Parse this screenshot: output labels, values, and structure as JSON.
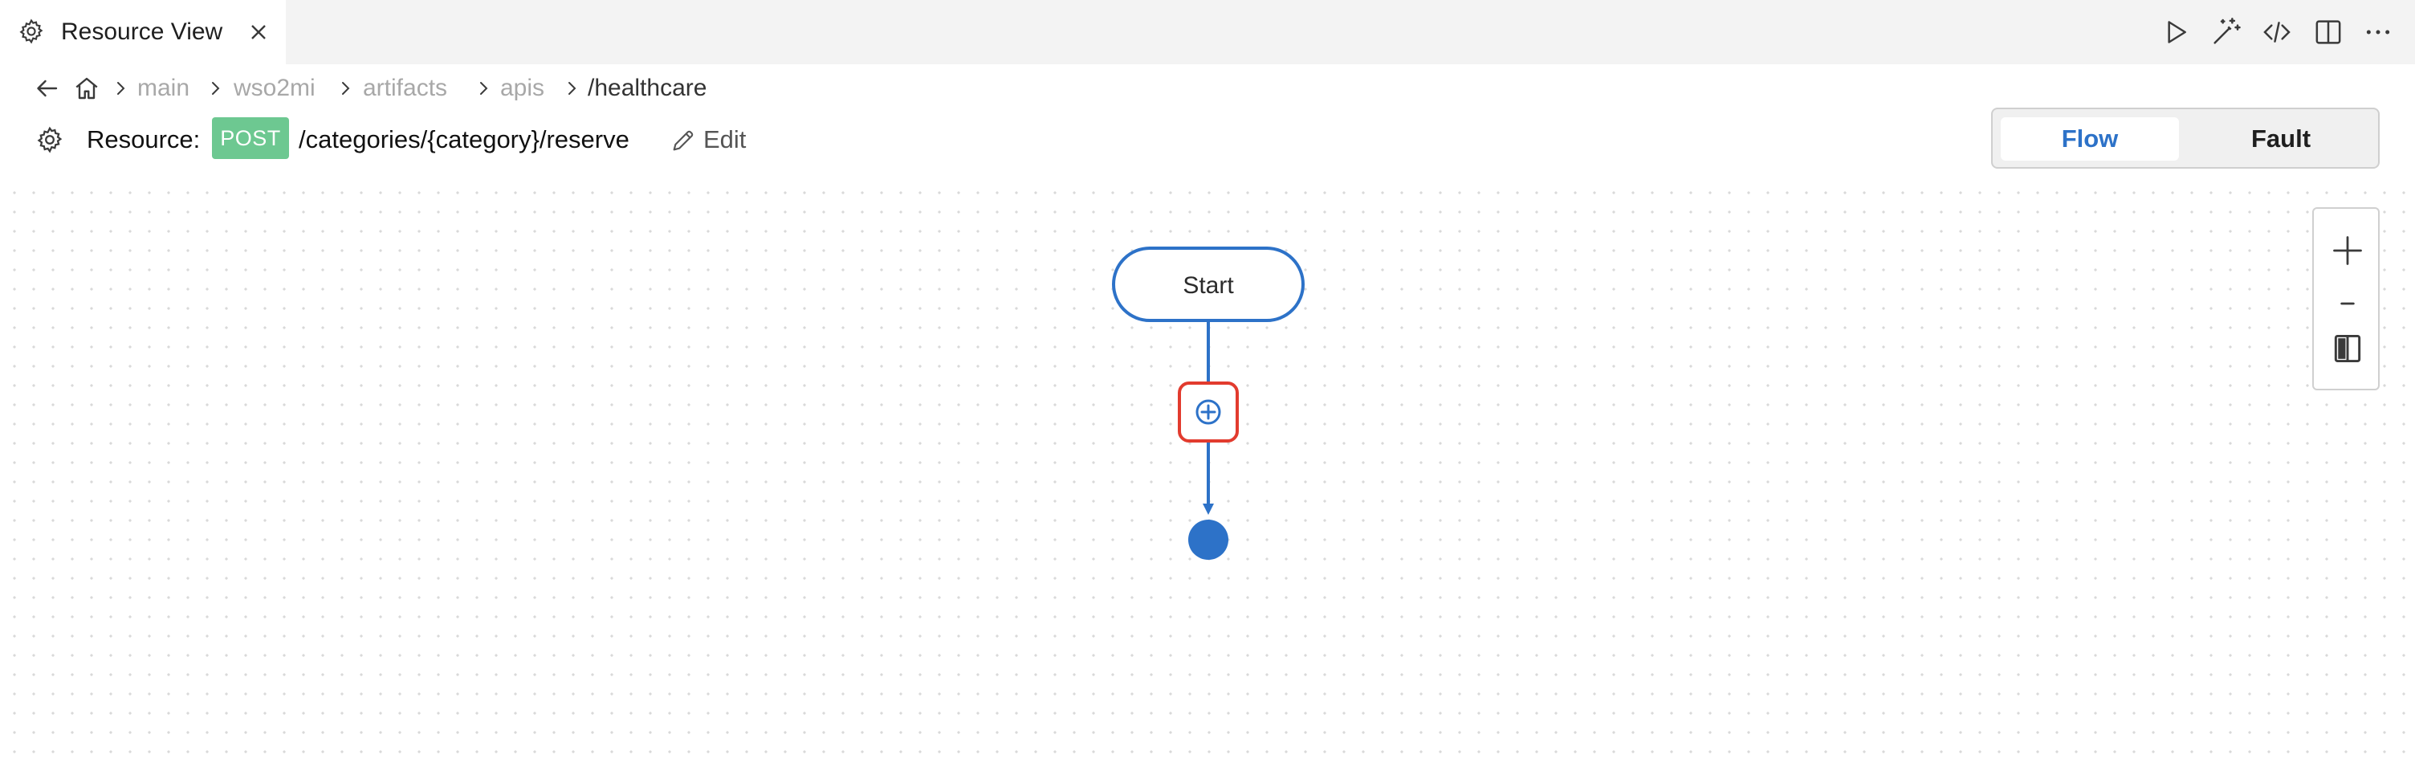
{
  "tab": {
    "title": "Resource View",
    "icon": "gear-icon",
    "close_icon": "close-icon"
  },
  "toolbar": {
    "actions": [
      {
        "name": "run-button",
        "icon": "play-icon"
      },
      {
        "name": "magic-button",
        "icon": "magic-wand-icon"
      },
      {
        "name": "source-code-button",
        "icon": "code-icon"
      },
      {
        "name": "split-editor-button",
        "icon": "split-view-icon"
      },
      {
        "name": "more-actions-button",
        "icon": "ellipsis-icon"
      }
    ]
  },
  "breadcrumb": {
    "items": [
      "main",
      "wso2mi",
      "artifacts",
      "apis",
      "/healthcare"
    ]
  },
  "resource": {
    "label": "Resource:",
    "method": "POST",
    "path": "/categories/{category}/reserve",
    "edit_label": "Edit"
  },
  "view_switch": {
    "flow_label": "Flow",
    "fault_label": "Fault",
    "active": "Flow"
  },
  "diagram": {
    "start_label": "Start"
  },
  "colors": {
    "accent": "#2d72c8",
    "method_post": "#6dc891",
    "highlight": "#e23b2e",
    "tab_bar": "#f3f3f3"
  }
}
